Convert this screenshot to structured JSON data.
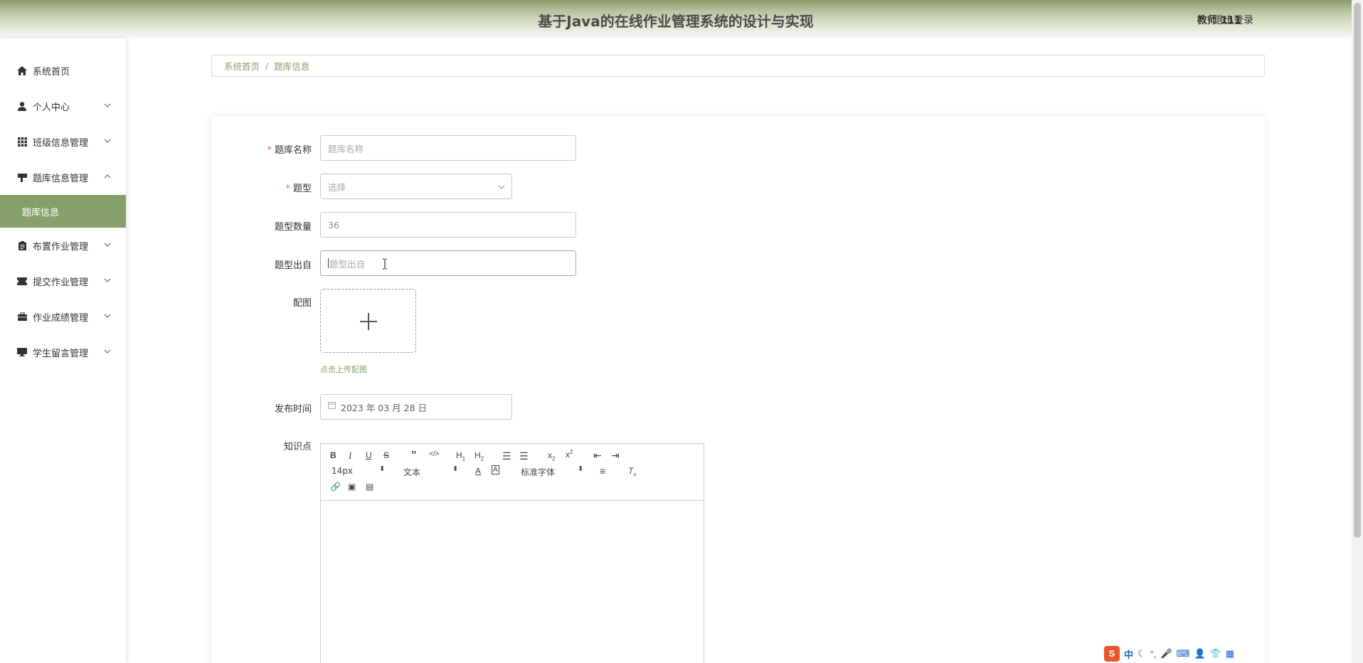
{
  "header": {
    "title": "基于Java的在线作业管理系统的设计与实现",
    "user": "教师 111",
    "logout": "退出登录"
  },
  "sidebar": {
    "items": [
      {
        "label": "系统首页",
        "icon": "home-icon",
        "expandable": false
      },
      {
        "label": "个人中心",
        "icon": "user-icon",
        "expandable": true
      },
      {
        "label": "班级信息管理",
        "icon": "grid-icon",
        "expandable": true
      },
      {
        "label": "题库信息管理",
        "icon": "flag-icon",
        "expandable": true,
        "expanded": true
      },
      {
        "label": "布置作业管理",
        "icon": "clipboard-icon",
        "expandable": true
      },
      {
        "label": "提交作业管理",
        "icon": "ticket-icon",
        "expandable": true
      },
      {
        "label": "作业成绩管理",
        "icon": "briefcase-icon",
        "expandable": true
      },
      {
        "label": "学生留言管理",
        "icon": "monitor-icon",
        "expandable": true
      }
    ],
    "active_sub": "题库信息"
  },
  "breadcrumb": {
    "home": "系统首页",
    "sep": "/",
    "current": "题库信息"
  },
  "form": {
    "name_label": "题库名称",
    "name_placeholder": "题库名称",
    "type_label": "题型",
    "type_placeholder": "选择",
    "count_label": "题型数量",
    "count_value": "36",
    "source_label": "题型出自",
    "source_placeholder": "题型出自",
    "image_label": "配图",
    "upload_tip": "点击上传配图",
    "date_label": "发布时间",
    "date_value": "2023 年 03 月 28 日",
    "knowledge_label": "知识点"
  },
  "editor": {
    "font_size": "14px",
    "header_select": "文本",
    "font_family": "标准字体"
  },
  "colors": {
    "accent": "#87a06a",
    "required": "#f56c6c"
  }
}
